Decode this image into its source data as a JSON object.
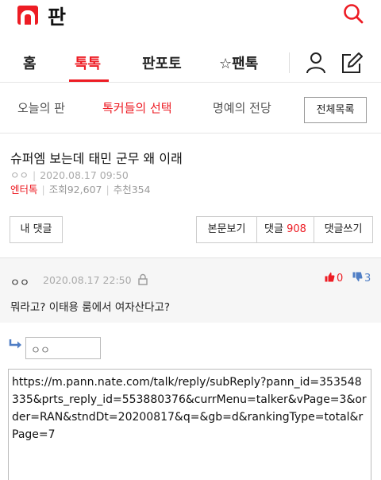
{
  "header": {
    "brand": "판"
  },
  "nav": {
    "home": "홈",
    "talk": "톡톡",
    "photo": "판포토",
    "pantalk": "☆팬톡"
  },
  "subnav": {
    "today": "오늘의 판",
    "choice": "톡커들의 선택",
    "fame": "명예의 전당",
    "all_list": "전체목록"
  },
  "post": {
    "title": "슈퍼엠 보는데 태민 군무 왜 이래",
    "author": "ㅇㅇ",
    "date": "2020.08.17 09:50",
    "category": "엔터톡",
    "views": "조회92,607",
    "recommend": "추천354"
  },
  "buttons": {
    "my_comment": "내 댓글",
    "view_body": "본문보기",
    "comment_label": "댓글",
    "comment_count": "908",
    "write_comment": "댓글쓰기"
  },
  "comment": {
    "author": "ㅇㅇ",
    "date": "2020.08.17 22:50",
    "likes": "0",
    "dislikes": "3",
    "text": "뭐라고? 이태용 룸에서 여자산다고?"
  },
  "reply": {
    "name": "ㅇㅇ",
    "content": "https://m.pann.nate.com/talk/reply/subReply?pann_id=353548335&prts_reply_id=553880376&currMenu=talker&vPage=3&order=RAN&stndDt=20200817&q=&gb=d&rankingType=total&rPage=7"
  },
  "colors": {
    "accent": "#ed1c24",
    "dislike": "#4f7ec5"
  }
}
